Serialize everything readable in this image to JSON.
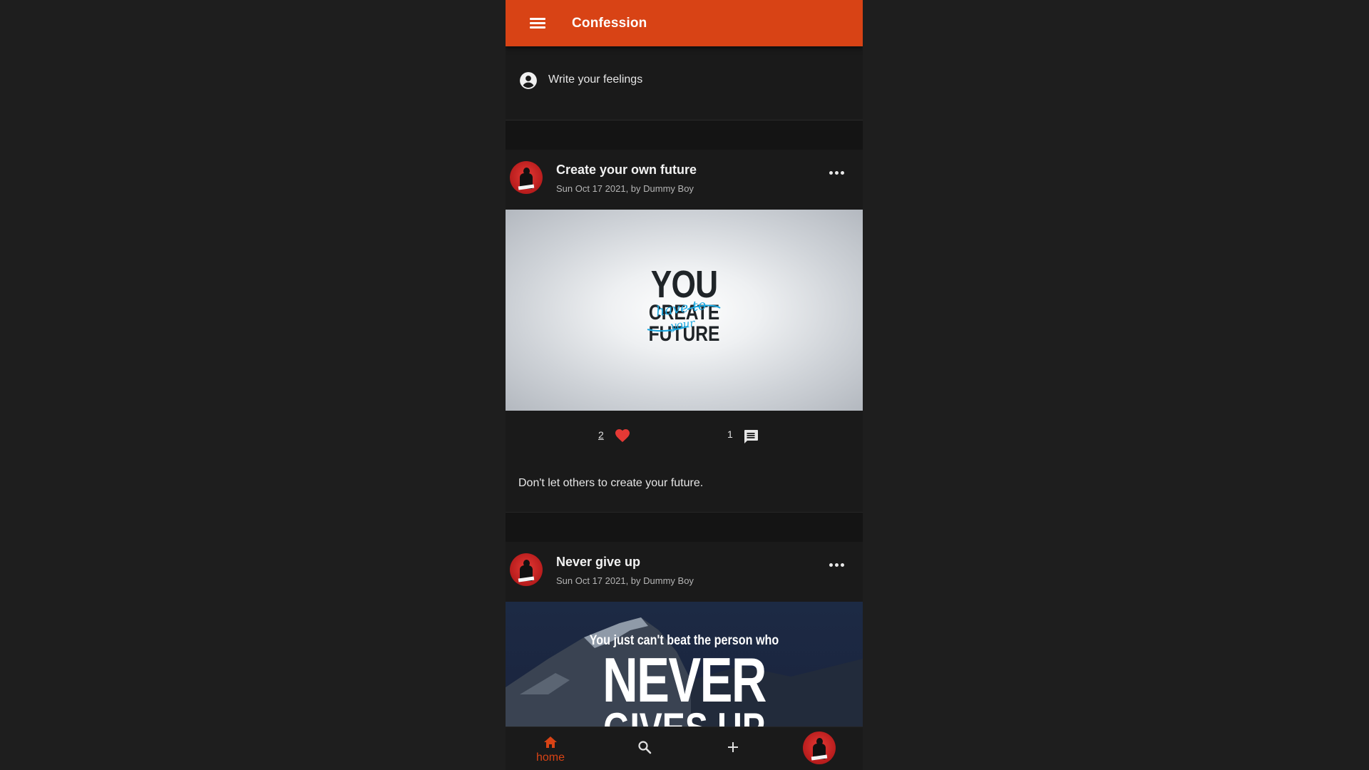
{
  "app": {
    "title": "Confession",
    "colors": {
      "primary": "#d84315",
      "background": "#141414",
      "surface": "#1a1a1a",
      "like": "#e53935"
    }
  },
  "header": {
    "menu_icon": "menu-icon"
  },
  "composer": {
    "icon": "account-circle-icon",
    "placeholder_text": "Write your feelings"
  },
  "posts": [
    {
      "title": "Create your own future",
      "meta": "Sun Oct 17 2021, by Dummy Boy",
      "image_text": {
        "line1": "YOU",
        "script1": "have to",
        "line2": "CREATE",
        "script2": "your",
        "line3": "FUTURE"
      },
      "likes": "2",
      "comments": "1",
      "body": "Don't let others to create your future."
    },
    {
      "title": "Never give up",
      "meta": "Sun Oct 17 2021, by Dummy Boy",
      "image_text": {
        "line1": "You just can't beat the person who",
        "line2": "NEVER",
        "line3": "GIVES UP"
      }
    }
  ],
  "bottom_nav": {
    "items": [
      {
        "icon": "home-icon",
        "label": "home",
        "active": true
      },
      {
        "icon": "search-icon"
      },
      {
        "icon": "add-icon"
      },
      {
        "icon": "profile-avatar"
      }
    ]
  }
}
